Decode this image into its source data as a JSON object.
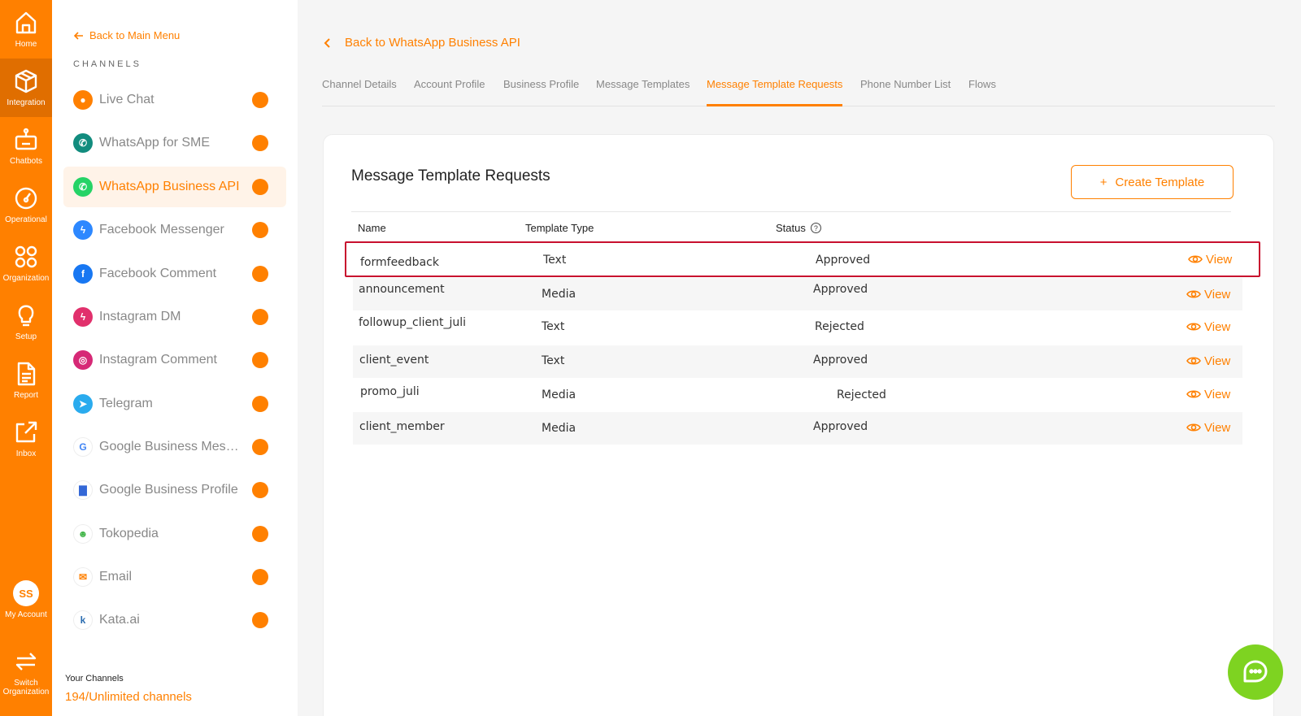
{
  "rail": {
    "items": [
      {
        "label": "Home",
        "icon": "home-icon"
      },
      {
        "label": "Integration",
        "icon": "cube-icon"
      },
      {
        "label": "Chatbots",
        "icon": "robot-icon"
      },
      {
        "label": "Operational",
        "icon": "gauge-icon"
      },
      {
        "label": "Organization",
        "icon": "grid-icon"
      },
      {
        "label": "Setup",
        "icon": "lightbulb-icon"
      },
      {
        "label": "Report",
        "icon": "document-icon"
      },
      {
        "label": "Inbox",
        "icon": "external-link-icon"
      },
      {
        "label": "My Account",
        "icon": "avatar",
        "initials": "SS"
      },
      {
        "label": "Switch Organization",
        "icon": "switch-icon"
      }
    ],
    "active_index": 1,
    "color": "#ff8000"
  },
  "channels_panel": {
    "back_label": "Back to Main Menu",
    "heading": "CHANNELS",
    "items": [
      {
        "label": "Live Chat",
        "icon": "live-chat-icon",
        "color": "#ff8000"
      },
      {
        "label": "WhatsApp for SME",
        "icon": "whatsapp-sme-icon",
        "color": "#128c7e"
      },
      {
        "label": "WhatsApp Business API",
        "icon": "whatsapp-icon",
        "color": "#25d366",
        "active": true
      },
      {
        "label": "Facebook Messenger",
        "icon": "messenger-icon",
        "color": "#2d88ff"
      },
      {
        "label": "Facebook Comment",
        "icon": "facebook-icon",
        "color": "#1877f2"
      },
      {
        "label": "Instagram DM",
        "icon": "instagram-dm-icon",
        "color": "#e1306c"
      },
      {
        "label": "Instagram Comment",
        "icon": "instagram-icon",
        "color": "#d62976"
      },
      {
        "label": "Telegram",
        "icon": "telegram-icon",
        "color": "#2aabee"
      },
      {
        "label": "Google Business Messages",
        "icon": "google-icon",
        "color": "#4285f4"
      },
      {
        "label": "Google Business Profile",
        "icon": "google-business-profile-icon",
        "color": "#3367d6"
      },
      {
        "label": "Tokopedia",
        "icon": "tokopedia-icon",
        "color": "#42b549"
      },
      {
        "label": "Email",
        "icon": "email-icon",
        "color": "#ff8000"
      },
      {
        "label": "Kata.ai",
        "icon": "kata-icon",
        "color": "#2b6cb0"
      }
    ],
    "footer_label": "Your Channels",
    "footer_count": "194/Unlimited channels"
  },
  "main": {
    "back_label": "Back to WhatsApp Business API",
    "tabs": [
      {
        "label": "Channel Details"
      },
      {
        "label": "Account Profile"
      },
      {
        "label": "Business Profile"
      },
      {
        "label": "Message Templates"
      },
      {
        "label": "Message Template Requests",
        "active": true
      },
      {
        "label": "Phone Number List"
      },
      {
        "label": "Flows"
      }
    ],
    "card": {
      "title": "Message Template Requests",
      "create_label": "Create Template",
      "columns": {
        "name": "Name",
        "type": "Template Type",
        "status": "Status"
      },
      "rows": [
        {
          "name": "formfeedback",
          "type": "Text",
          "status": "Approved",
          "action": "View"
        },
        {
          "name": "announcement",
          "type": "Media",
          "status": "Approved",
          "action": "View"
        },
        {
          "name": "followup_client_juli",
          "type": "Text",
          "status": "Rejected",
          "action": "View"
        },
        {
          "name": "client_event",
          "type": "Text",
          "status": "Approved",
          "action": "View"
        },
        {
          "name": "promo_juli",
          "type": "Media",
          "status": "Rejected",
          "action": "View"
        },
        {
          "name": "client_member",
          "type": "Media",
          "status": "Approved",
          "action": "View"
        }
      ]
    }
  }
}
